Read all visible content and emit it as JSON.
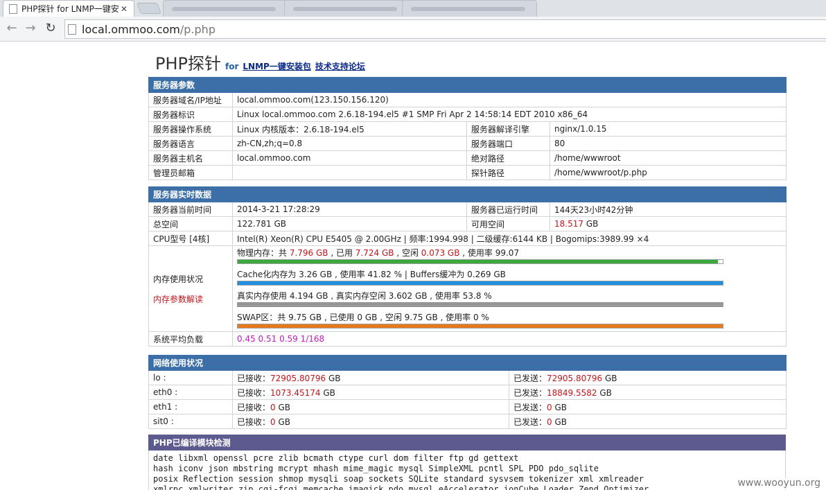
{
  "browser": {
    "active_tab_title": "PHP探针 for LNMP一键安",
    "url_host": "local.ommoo.com",
    "url_path": "/p.php"
  },
  "page": {
    "title": "PHP探针",
    "for_label": "for",
    "link_lnmp": "LNMP一键安装包",
    "link_forum": "技术支持论坛"
  },
  "server_params": {
    "header": "服务器参数",
    "rows": [
      {
        "label": "服务器域名/IP地址",
        "value": "local.ommoo.com(123.150.156.120)"
      },
      {
        "label": "服务器标识",
        "value": "Linux local.ommoo.com 2.6.18-194.el5 #1 SMP Fri Apr 2 14:58:14 EDT 2010 x86_64"
      },
      {
        "label": "服务器操作系统",
        "value": "Linux  内核版本：2.6.18-194.el5",
        "label2": "服务器解译引擎",
        "value2": "nginx/1.0.15"
      },
      {
        "label": "服务器语言",
        "value": "zh-CN,zh;q=0.8",
        "label2": "服务器端口",
        "value2": "80"
      },
      {
        "label": "服务器主机名",
        "value": "local.ommoo.com",
        "label2": "绝对路径",
        "value2": "/home/wwwroot"
      },
      {
        "label": "管理员邮箱",
        "value": "",
        "label2": "探针路径",
        "value2": "/home/wwwroot/p.php"
      }
    ]
  },
  "realtime": {
    "header": "服务器实时数据",
    "time_label": "服务器当前时间",
    "time_value": "2014-3-21 17:28:29",
    "uptime_label": "服务器已运行时间",
    "uptime_value": "144天23小时42分钟",
    "disk_label": "总空间",
    "disk_value": "122.781 GB",
    "free_label": "可用空间",
    "free_value": "18.517",
    "free_unit": " GB",
    "cpu_label": "CPU型号 [4核]",
    "cpu_value": "Intel(R) Xeon(R) CPU E5405 @ 2.00GHz | 频率:1994.998 | 二级缓存:6144 KB | Bogomips:3989.99 ×4",
    "mem_label": "内存使用状况",
    "mem_link": "内存参数解读",
    "mem": {
      "phys_a": "物理内存：共 ",
      "phys_total": "7.796 GB",
      "phys_b": " , 已用 ",
      "phys_used": "7.724 GB",
      "phys_c": " , 空闲 ",
      "phys_free": "0.073 GB",
      "phys_d": " , 使用率 99.07",
      "phys_pct": 99.07,
      "cache_text": "Cache化内存为 3.26 GB , 使用率 41.82 % | Buffers缓冲为 0.269 GB",
      "cache_pct": 100,
      "real_text": "真实内存使用 4.194 GB , 真实内存空闲 3.602 GB , 使用率 53.8 %",
      "real_pct": 100,
      "swap_text": "SWAP区：共 9.75 GB , 已使用 0 GB , 空闲 9.75 GB , 使用率 0 %",
      "swap_pct": 100
    },
    "load_label": "系统平均负载",
    "load_value": "0.45 0.51 0.59 1/168"
  },
  "network": {
    "header": "网络使用状况",
    "recv_label": "已接收：",
    "send_label": "已发送：",
    "rows": [
      {
        "iface": "lo :",
        "recv": "72905.80796",
        "send": "72905.80796"
      },
      {
        "iface": "eth0 :",
        "recv": "1073.45174",
        "send": "18849.5582"
      },
      {
        "iface": "eth1 :",
        "recv": "0",
        "send": "0"
      },
      {
        "iface": "sit0 :",
        "recv": "0",
        "send": "0"
      }
    ],
    "unit": " GB"
  },
  "modules": {
    "header": "PHP已编译模块检测",
    "lines": [
      "date  libxml  openssl  pcre  zlib  bcmath  ctype  curl  dom  filter  ftp  gd  gettext",
      "hash  iconv  json  mbstring  mcrypt  mhash  mime_magic  mysql  SimpleXML  pcntl  SPL  PDO  pdo_sqlite",
      "posix  Reflection  session  shmop  mysqli  soap  sockets  SQLite  standard  sysvsem  tokenizer  xml  xmlreader",
      "xmlrpc  xmlwriter  zip  cgi-fcgi  memcache  imagick  pdo_mysql  eAccelerator  ionCube Loader  Zend Optimizer"
    ]
  },
  "colors": {
    "bar_phys": "#3aa83a",
    "bar_cache": "#1f8fe0",
    "bar_swap": "#e87a1c"
  },
  "watermark": "www.wooyun.org"
}
